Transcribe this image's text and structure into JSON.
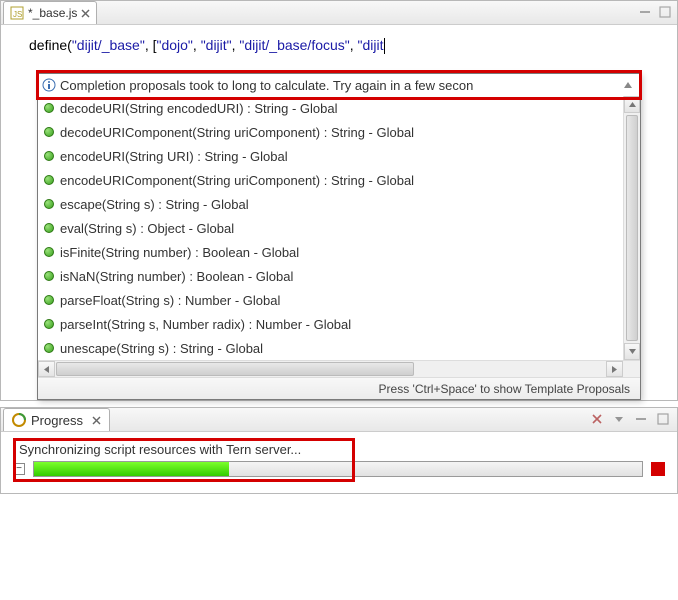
{
  "editor": {
    "tab": {
      "title": "*_base.js"
    },
    "code": {
      "fn": "define",
      "args_open": "(",
      "str1": "\"dijit/_base\"",
      "comma1": ", ",
      "brkt_open": "[",
      "a1": "\"dojo\"",
      "c1": ", ",
      "a2": "\"dijit\"",
      "c2": ", ",
      "a3": "\"dijit/_base/focus\"",
      "c3": ", ",
      "a4": "\"dijit"
    }
  },
  "popup": {
    "message": "Completion proposals took to long to calculate. Try again in a few secon",
    "footer": "Press 'Ctrl+Space' to show Template Proposals",
    "items": [
      "decodeURI(String encodedURI) : String - Global",
      "decodeURIComponent(String uriComponent) : String - Global",
      "encodeURI(String URI) : String - Global",
      "encodeURIComponent(String uriComponent) : String - Global",
      "escape(String s) : String - Global",
      "eval(String s) : Object - Global",
      "isFinite(String number) : Boolean - Global",
      "isNaN(String number) : Boolean - Global",
      "parseFloat(String s) : Number - Global",
      "parseInt(String s, Number radix) : Number - Global",
      "unescape(String s) : String - Global"
    ]
  },
  "progress": {
    "tab": "Progress",
    "task": "Synchronizing script resources with Tern server..."
  }
}
